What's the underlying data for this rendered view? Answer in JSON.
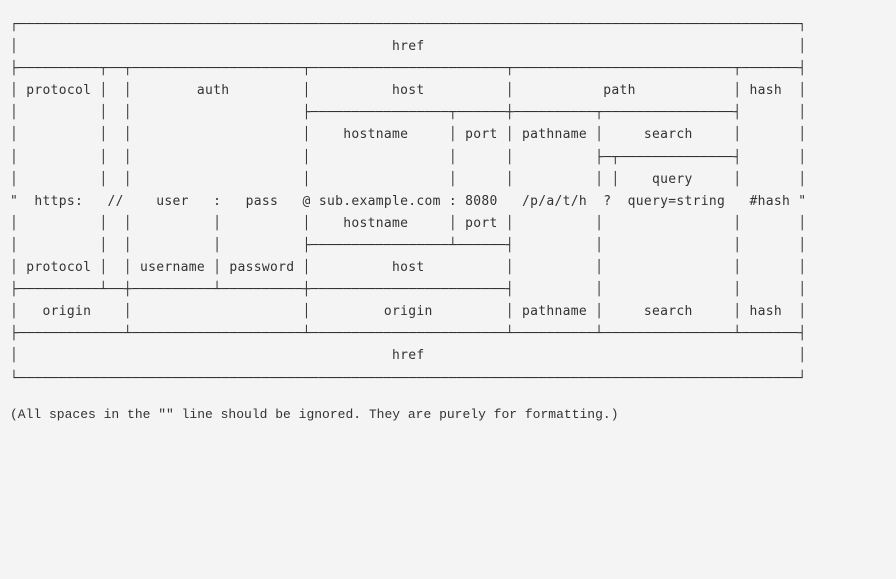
{
  "diagram": {
    "line00": "┌────────────────────────────────────────────────────────────────────────────────────────────────┐",
    "line01": "│                                              href                                              │",
    "line02": "├──────────┬──┬─────────────────────┬────────────────────────┬───────────────────────────┬───────┤",
    "line03": "│ protocol │  │        auth         │          host          │           path            │ hash  │",
    "line04": "│          │  │                     ├─────────────────┬──────┼──────────┬────────────────┤       │",
    "line05": "│          │  │                     │    hostname     │ port │ pathname │     search     │       │",
    "line06": "│          │  │                     │                 │      │          ├─┬──────────────┤       │",
    "line07": "│          │  │                     │                 │      │          │ │    query     │       │",
    "line08": "\"  https:   //    user   :   pass   @ sub.example.com : 8080   /p/a/t/h  ?  query=string   #hash \"",
    "line09": "│          │  │          │          │    hostname     │ port │          │                │       │",
    "line10": "│          │  │          │          ├─────────────────┴──────┤          │                │       │",
    "line11": "│ protocol │  │ username │ password │          host          │          │                │       │",
    "line12": "├──────────┴──┼──────────┴──────────┼────────────────────────┤          │                │       │",
    "line13": "│   origin    │                     │         origin         │ pathname │     search     │ hash  │",
    "line14": "├─────────────┴─────────────────────┴────────────────────────┴──────────┴────────────────┴───────┤",
    "line15": "│                                              href                                              │",
    "line16": "└────────────────────────────────────────────────────────────────────────────────────────────────┘"
  },
  "note": "(All spaces in the \"\" line should be ignored. They are purely for formatting.)"
}
